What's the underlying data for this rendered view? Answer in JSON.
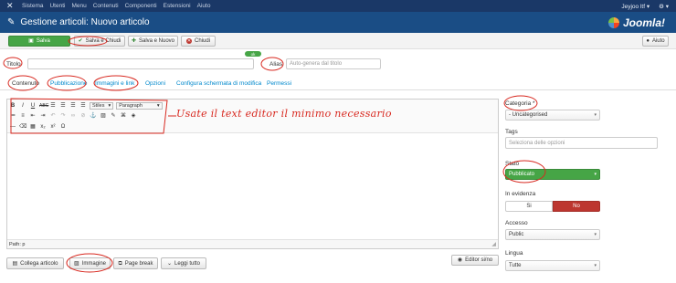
{
  "topnav": {
    "logo_icon": "joomla-x-icon",
    "menu": [
      "Sistema",
      "Utenti",
      "Menu",
      "Contenuti",
      "Componenti",
      "Estensioni",
      "Aiuto"
    ],
    "user": "Jeyjoo ltf ▾",
    "settings": "⚙ ▾"
  },
  "header": {
    "title": "Gestione articoli: Nuovo articolo",
    "brand": "Joomla!"
  },
  "toolbar": {
    "save": "Salva",
    "save_close": "Salva e Chiudi",
    "save_new": "Salva e Nuovo",
    "close": "Chiudi",
    "help": "Aiuto"
  },
  "form": {
    "title_label": "Titolo",
    "title_value": "",
    "pill": "ok",
    "alias_label": "Alias",
    "alias_placeholder": "Auto-genera dal titolo"
  },
  "tabs": [
    "Contenuto",
    "Pubblicazione",
    "Immagini e link",
    "Opzioni",
    "Configura schermata di modifica",
    "Permessi"
  ],
  "editor": {
    "style_select": "Stiles",
    "format_select": "Paragraph",
    "path": "Path: p",
    "annotation": "Usate il text editor il minimo necessario"
  },
  "editor_buttons": {
    "article": "Collega articolo",
    "image": "Immagine",
    "pagebreak": "Page break",
    "readmore": "Leggi tutto",
    "toggle": "Editor si/no"
  },
  "sidebar": {
    "category_label": "Categoria *",
    "category_value": "- Uncategorised",
    "tags_label": "Tags",
    "tags_placeholder": "Seleziona delle opzioni",
    "state_label": "Stato",
    "state_value": "Pubblicato",
    "featured_label": "In evidenza",
    "featured_yes": "Si",
    "featured_no": "No",
    "access_label": "Accesso",
    "access_value": "Public",
    "language_label": "Lingua",
    "language_value": "Tutte"
  },
  "colors": {
    "nav": "#1a3867",
    "header": "#1a4d85",
    "green": "#46a546",
    "red": "#bd362f",
    "annotation": "#d8281f"
  }
}
